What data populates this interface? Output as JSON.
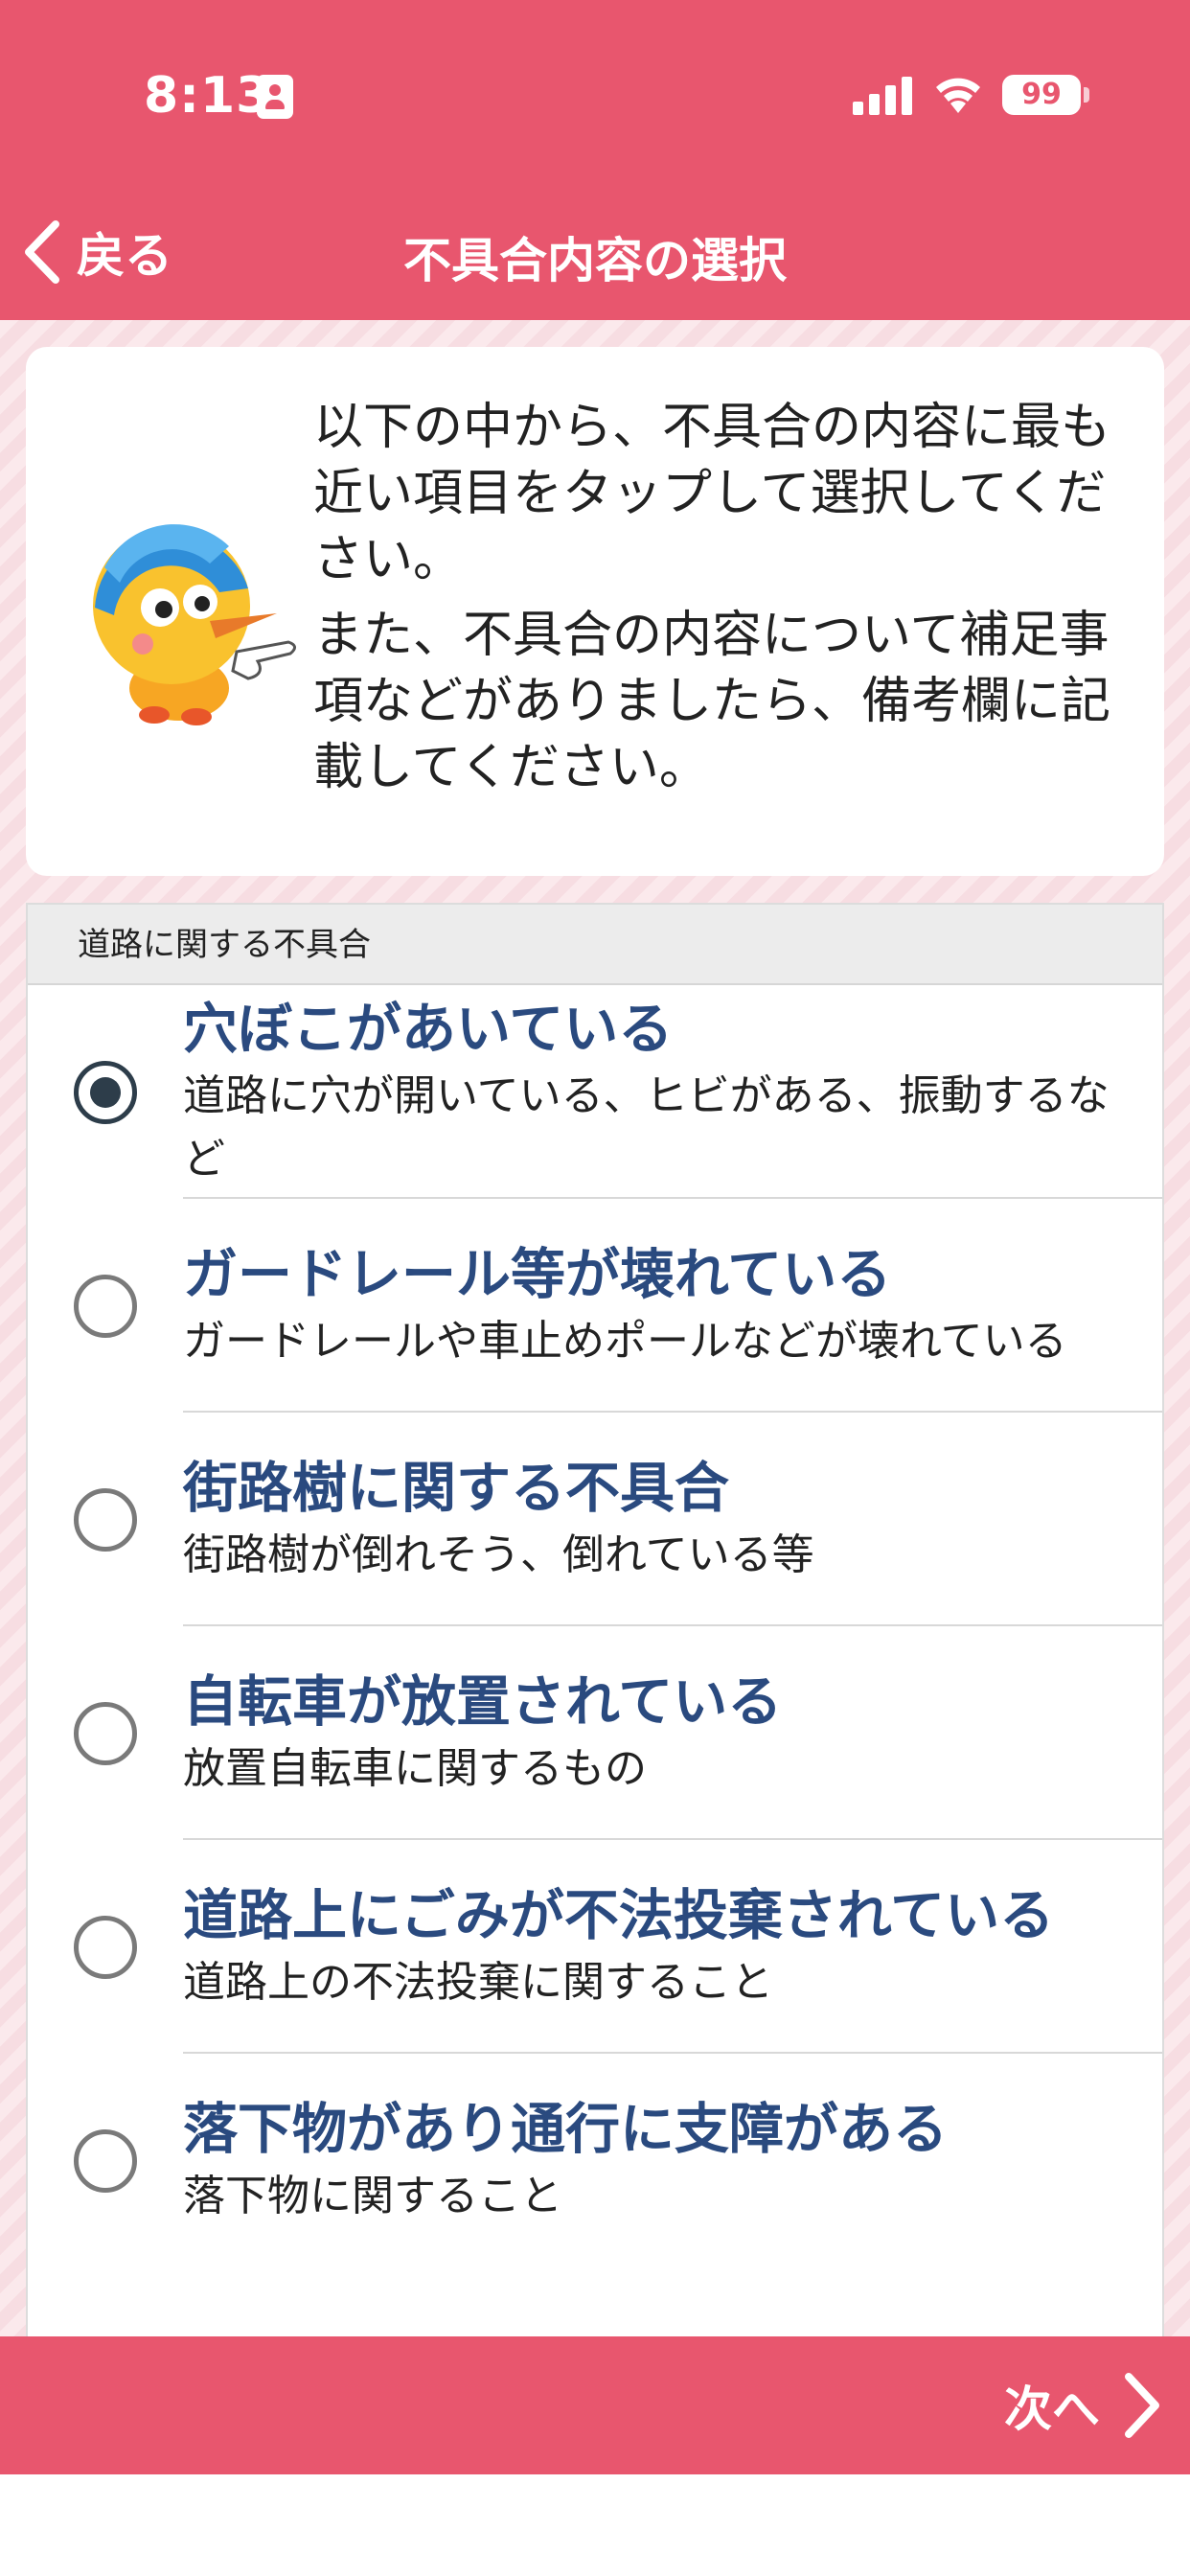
{
  "status_bar": {
    "time": "8:13",
    "battery": "99",
    "icons": [
      "person-badge-icon",
      "cellular-signal-icon",
      "wifi-icon",
      "battery-icon"
    ]
  },
  "nav": {
    "back_label": "戻る",
    "title": "不具合内容の選択"
  },
  "intro": {
    "paragraph1": "以下の中から、不具合の内容に最も近い項目をタップして選択してください。",
    "paragraph2": "また、不具合の内容について補足事項などがありましたら、備考欄に記載してください。"
  },
  "section": {
    "header": "道路に関する不具合",
    "items": [
      {
        "title": "穴ぼこがあいている",
        "desc": "道路に穴が開いている、ヒビがある、振動するなど",
        "selected": true
      },
      {
        "title": "ガードレール等が壊れている",
        "desc": "ガードレールや車止めポールなどが壊れている",
        "selected": false
      },
      {
        "title": "街路樹に関する不具合",
        "desc": "街路樹が倒れそう、倒れている等",
        "selected": false
      },
      {
        "title": "自転車が放置されている",
        "desc": "放置自転車に関するもの",
        "selected": false
      },
      {
        "title": "道路上にごみが不法投棄されている",
        "desc": "道路上の不法投棄に関すること",
        "selected": false
      },
      {
        "title": "落下物があり通行に支障がある",
        "desc": "落下物に関すること",
        "selected": false
      }
    ]
  },
  "footer": {
    "next_label": "次へ"
  },
  "colors": {
    "brand": "#e8566e",
    "item_title": "#2a4a7f",
    "radio_selected": "#2d3d4a"
  }
}
